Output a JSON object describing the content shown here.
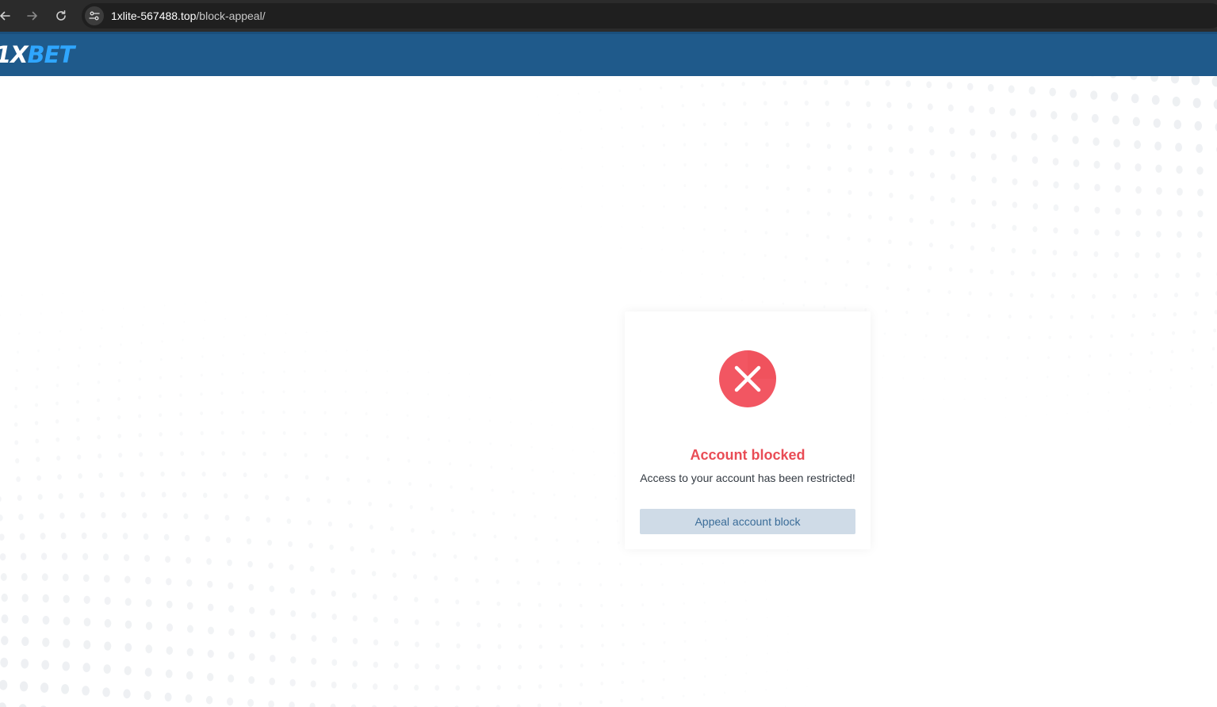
{
  "browser": {
    "url_host": "1xlite-567488.top",
    "url_path": "/block-appeal/",
    "icons": {
      "back": "arrow-left-icon",
      "forward": "arrow-right-icon",
      "reload": "reload-icon",
      "site_info": "tune-icon"
    }
  },
  "header": {
    "logo_part1": "1X",
    "logo_part2": "BET",
    "colors": {
      "background": "#1f5a8b",
      "logo_white": "#ffffff",
      "logo_blue": "#2fa6ff"
    }
  },
  "dialog": {
    "icon": "error-circle-x-icon",
    "title": "Account blocked",
    "message": "Access to your account has been restricted!",
    "button_label": "Appeal account block",
    "colors": {
      "error": "#f25662",
      "title": "#e94c55",
      "button_bg": "#cfdbe7",
      "button_text": "#3a6c98"
    }
  }
}
